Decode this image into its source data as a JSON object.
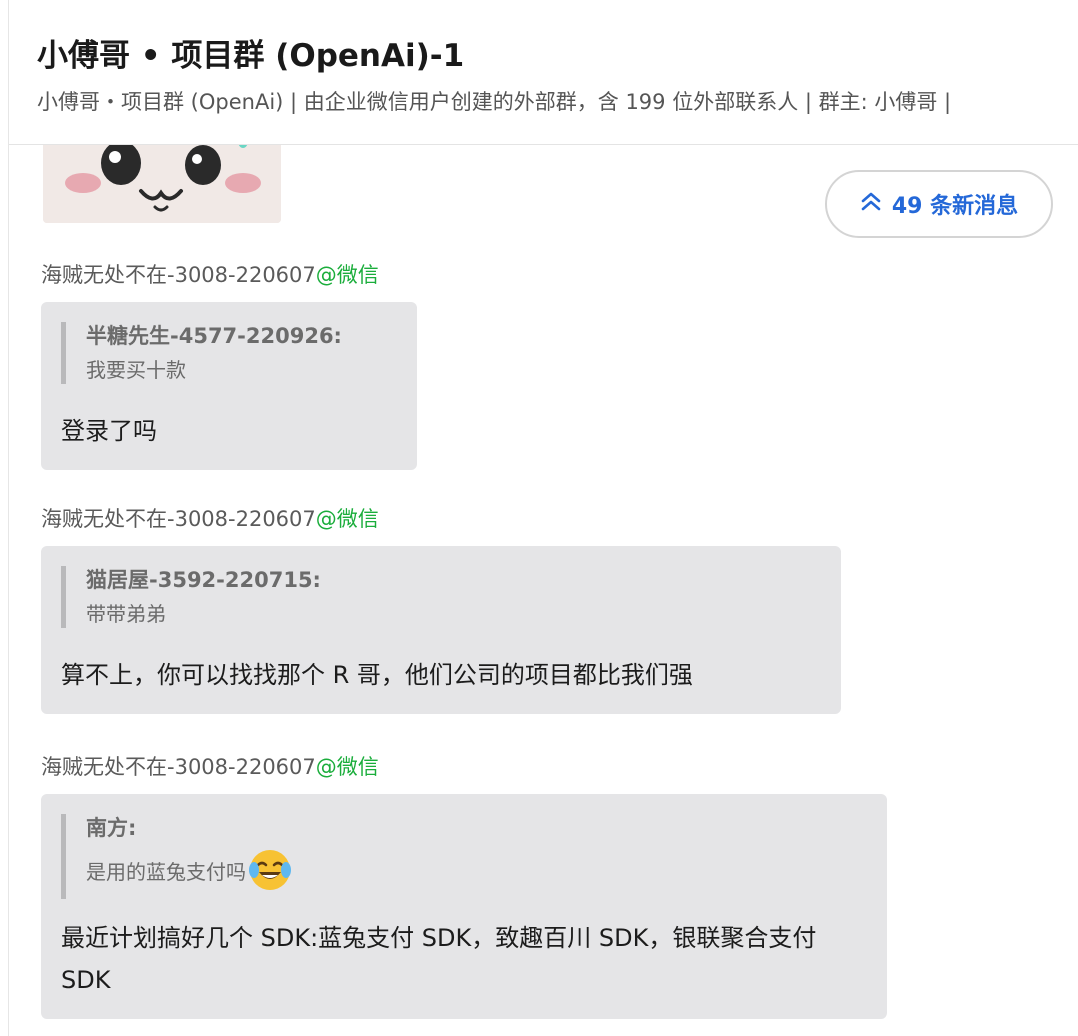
{
  "header": {
    "title": "小傅哥 • 项目群 (OpenAi)-1",
    "subtitle": "小傅哥・项目群 (OpenAi) | 由企业微信用户创建的外部群，含 199 位外部联系人 | 群主: 小傅哥 |"
  },
  "new_messages": {
    "label": "49 条新消息",
    "icon": "double-chevron-up-icon"
  },
  "messages": [
    {
      "sender": "海贼无处不在-3008-220607",
      "source": "@微信",
      "quote_author": "半糖先生-4577-220926:",
      "quote_text": "我要买十款",
      "text": "登录了吗"
    },
    {
      "sender": "海贼无处不在-3008-220607",
      "source": "@微信",
      "quote_author": "猫居屋-3592-220715:",
      "quote_text": "带带弟弟",
      "text": "算不上，你可以找找那个 R 哥，他们公司的项目都比我们强"
    },
    {
      "sender": "海贼无处不在-3008-220607",
      "source": "@微信",
      "quote_author": "南方:",
      "quote_text": "是用的蓝兔支付吗",
      "quote_emoji": "tears-of-joy-emoji",
      "text": "最近计划搞好几个 SDK:蓝兔支付 SDK，致趣百川 SDK，银联聚合支付 SDK"
    }
  ],
  "colors": {
    "accent_blue": "#2468d8",
    "wechat_green": "#1aad3b",
    "bubble_bg": "#e5e5e7"
  }
}
